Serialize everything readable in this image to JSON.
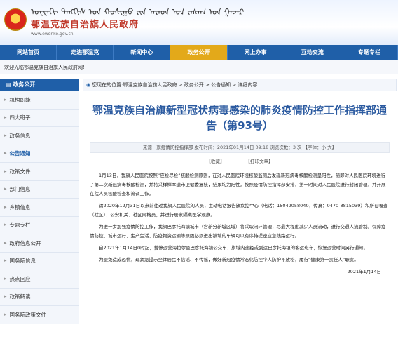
{
  "header": {
    "mongolian": "ᠣᠧᠧᠨᠭᠢ ᠲᠠᠩᠭᠢᠰ ᠤᠨ ᠬᠣᠰᠢᠭᠤ ᠶᠢᠨ ᠠᠷᠠᠳ ᠤᠨ ᠵᠠᠰᠠᠭ ᠤᠨ ᠭᠠᠵᠠᠷ",
    "title": "鄂温克族自治旗人民政府",
    "url": "www.ewenke.gov.cn"
  },
  "nav": [
    "网站首页",
    "走进鄂温克",
    "新闻中心",
    "政务公开",
    "网上办事",
    "互动交流",
    "专题专栏"
  ],
  "welcome": "欢迎光临鄂温克族自治旗人民政府网!",
  "sidebar": {
    "heading": "政务公开",
    "items": [
      "机构职能",
      "四大班子",
      "政务信息",
      "公告通知",
      "政策文件",
      "部门信息",
      "乡镇信息",
      "专题专栏",
      "政府信息公开",
      "国务院信息",
      "热点回应",
      "政策解读",
      "国务院政策文件"
    ]
  },
  "breadcrumb": "您现在的位置:鄂温克族自治旗人民政府 > 政务公开 > 公告通知 > 详细内容",
  "article": {
    "title": "鄂温克族自治旗新型冠状病毒感染的肺炎疫情防控工作指挥部通告（第93号）",
    "meta": "来源：旗疫情防控指挥部    发布时间：2021年01月14日 09:18    浏览次数：3 次    【字体：小 大】",
    "actions": [
      "【收藏】",
      "【打印文章】"
    ],
    "paragraphs": [
      "1月13日，我旗人民医院按照“应检尽检”核酸检测原则，在对人民医院环境核酸监测后发现新冠病毒核酸检测呈阳性，随即对人民医院环境进行了第二次新冠病毒核酸检测，并将采样样本送市卫健委复核，结果均为阳性。按照疫情防控指挥部安排，第一时间对人民医院进行封闭管理，并开展在院人员核酸检查和流调工作。",
      "请2020年12月31日以来前往过我旗人民医院的人员，主动电话报告旗疾控中心（电话：15049058040，传真：0470-8815039）和所在嘎查（社区）、公安机关、社区网格员，并进行居家隔离医学观察。",
      "为进一步加强疫情防控工作，我旗巴彦托海镇城市（含新分新城区域）将采取闭环管理，尽最大程度减少人员流动，进行交通人流管制。保障疫情防控、城市运行、生产生活、防疫物资运输等原因必须进出镇域的车辆可以有序持提速应急线路运行。",
      "自2021年1月14日0时起，暂停运营海拉尔至巴彦托海镇公交车、旗域内途经或到达巴彦托海镇的客运班车，恢复运营时间另行通知。",
      "为避免造成恐慌，现紧急提示全体居民不信谣、不传谣，做好新冠疫情常态化防控个人防护不放松，履行“健康第一责任人”职责。"
    ],
    "date": "2021年1月14日"
  }
}
